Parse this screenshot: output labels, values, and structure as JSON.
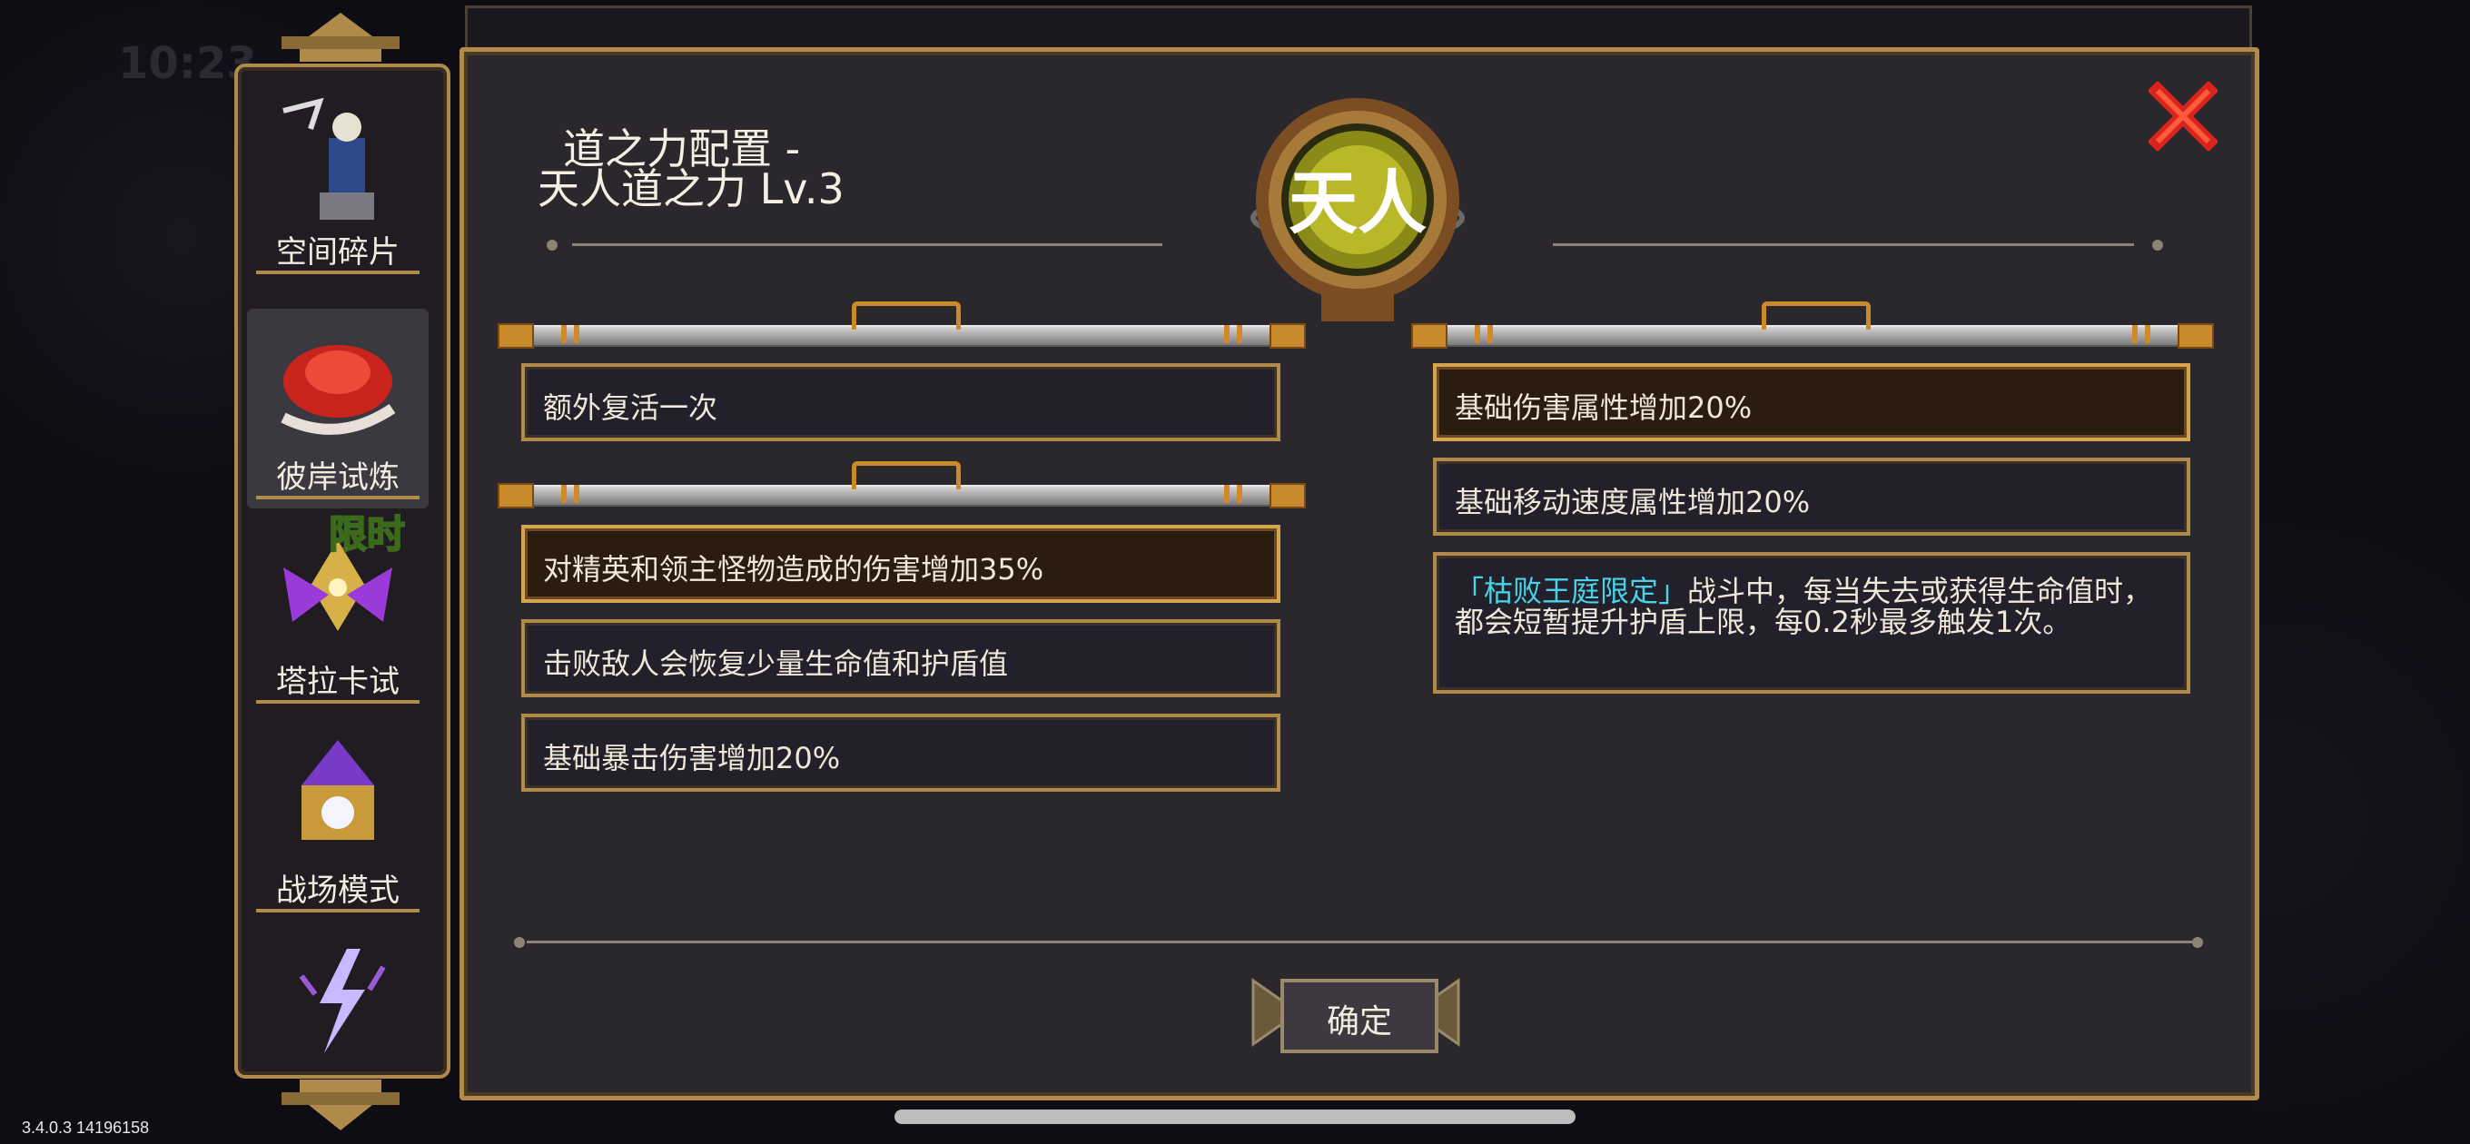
{
  "version": "3.4.0.3 14196158",
  "background_clock": "10:23",
  "sidebar": {
    "modes": [
      {
        "label": "空间碎片",
        "icon": "space-fragment-icon"
      },
      {
        "label": "彼岸试炼",
        "icon": "red-spider-lily-icon",
        "selected": true
      },
      {
        "label": "塔拉卡试",
        "icon": "taraka-trial-icon",
        "badge": "限时"
      },
      {
        "label": "战场模式",
        "icon": "battlefield-mode-icon"
      },
      {
        "label": "",
        "icon": "lightning-icon"
      }
    ]
  },
  "panel": {
    "title_line1": "道之力配置 -",
    "title_line2": "天人道之力 Lv.3",
    "emblem_glyph": "天人",
    "confirm_label": "确定"
  },
  "left_column": {
    "group1": [
      {
        "text": "额外复活一次"
      }
    ],
    "group2": [
      {
        "text": "对精英和领主怪物造成的伤害增加35%",
        "selected": true
      },
      {
        "text": "击败敌人会恢复少量生命值和护盾值"
      },
      {
        "text": "基础暴击伤害增加20%"
      }
    ]
  },
  "right_column": {
    "group1": [
      {
        "text": "基础伤害属性增加20%",
        "selected": true
      },
      {
        "text": "基础移动速度属性增加20%"
      },
      {
        "highlight": "「枯败王庭限定」",
        "text": "战斗中，每当失去或获得生命值时，都会短暂提升护盾上限，每0.2秒最多触发1次。"
      }
    ]
  },
  "colors": {
    "frame_gold": "#b08a4a",
    "highlight_cyan": "#4ad3e8",
    "close_red": "#d8241c"
  }
}
